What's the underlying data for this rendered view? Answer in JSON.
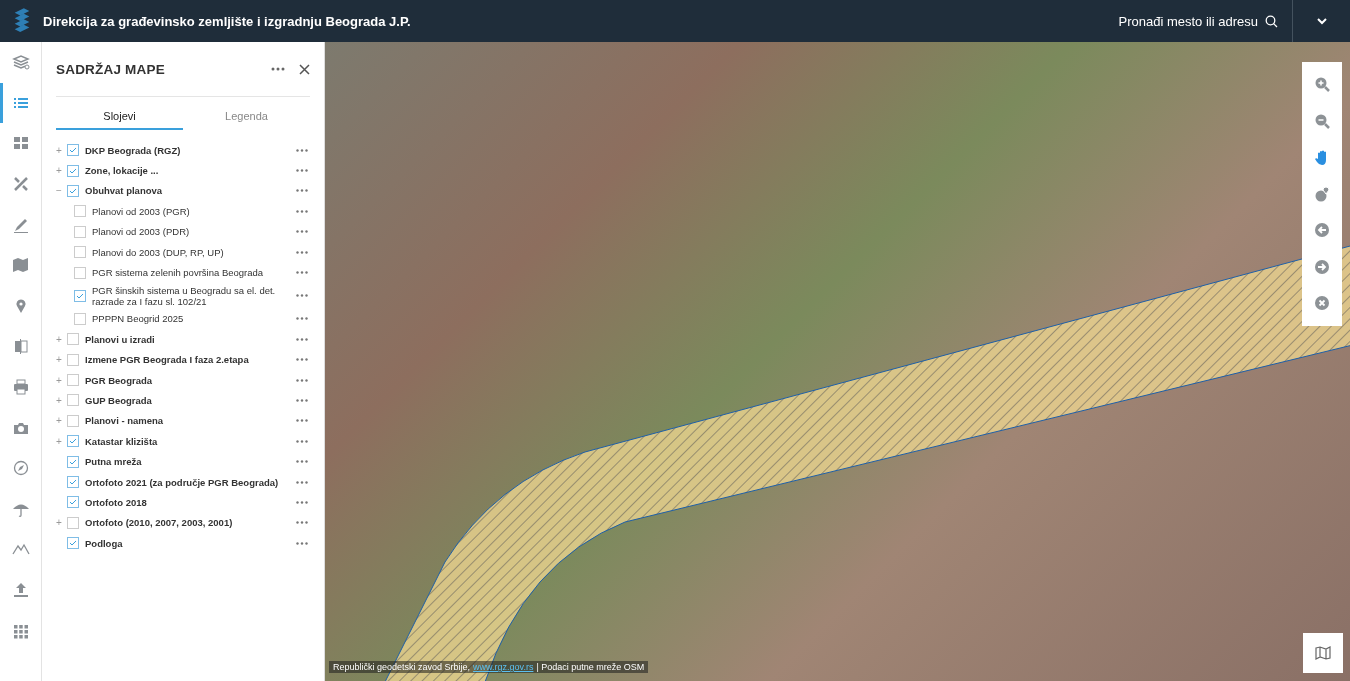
{
  "header": {
    "title": "Direkcija za građevinsko zemljište i izgradnju Beograda J.P.",
    "search": {
      "placeholder": "Pronađi mesto ili adresu"
    }
  },
  "rail": [
    {
      "kind": "layers",
      "selected": false
    },
    {
      "kind": "list",
      "selected": true
    },
    {
      "kind": "grid",
      "selected": false
    },
    {
      "kind": "tools",
      "selected": false
    },
    {
      "kind": "pen",
      "selected": false
    },
    {
      "kind": "map",
      "selected": false
    },
    {
      "kind": "pin",
      "selected": false
    },
    {
      "kind": "split",
      "selected": false
    },
    {
      "kind": "print",
      "selected": false
    },
    {
      "kind": "camera",
      "selected": false
    },
    {
      "kind": "compass",
      "selected": false
    },
    {
      "kind": "umbrella",
      "selected": false
    },
    {
      "kind": "mountains",
      "selected": false
    },
    {
      "kind": "upload",
      "selected": false
    },
    {
      "kind": "apps",
      "selected": false
    }
  ],
  "panel": {
    "title": "SADRŽAJ MAPE",
    "tabs": [
      {
        "label": "Slojevi",
        "selected": true
      },
      {
        "label": "Legenda",
        "selected": false
      }
    ],
    "layers": [
      {
        "label": "DKP Beograda (RGZ)",
        "toggle": "+",
        "checked": true
      },
      {
        "label": "Zone, lokacije ...",
        "toggle": "+",
        "checked": true
      },
      {
        "label": "Obuhvat planova",
        "toggle": "−",
        "checked": true,
        "children": [
          {
            "label": "Planovi od 2003 (PGR)",
            "checked": false
          },
          {
            "label": "Planovi od 2003 (PDR)",
            "checked": false
          },
          {
            "label": "Planovi do 2003 (DUP, RP, UP)",
            "checked": false
          },
          {
            "label": "PGR sistema zelenih površina Beograda",
            "checked": false
          },
          {
            "label": "PGR šinskih sistema u Beogradu sa el. det. razrade za I fazu sl. 102/21",
            "checked": true
          },
          {
            "label": "PPPPN Beogrid 2025",
            "checked": false
          }
        ]
      },
      {
        "label": "Planovi u izradi",
        "toggle": "+",
        "checked": false
      },
      {
        "label": "Izmene PGR Beograda I faza 2.etapa",
        "toggle": "+",
        "checked": false
      },
      {
        "label": "PGR Beograda",
        "toggle": "+",
        "checked": false
      },
      {
        "label": "GUP Beograda",
        "toggle": "+",
        "checked": false
      },
      {
        "label": "Planovi - namena",
        "toggle": "+",
        "checked": false
      },
      {
        "label": "Katastar klizišta",
        "toggle": "+",
        "checked": true
      },
      {
        "label": "Putna mreža",
        "checked": true
      },
      {
        "label": "Ortofoto 2021 (za područje PGR Beograda)",
        "checked": true
      },
      {
        "label": "Ortofoto 2018",
        "checked": true
      },
      {
        "label": "Ortofoto (2010, 2007, 2003, 2001)",
        "toggle": "+",
        "checked": false
      },
      {
        "label": "Podloga",
        "checked": true
      }
    ]
  },
  "map": {
    "tools": [
      {
        "kind": "zoomin",
        "selected": false
      },
      {
        "kind": "zoomout",
        "selected": false
      },
      {
        "kind": "pan",
        "selected": true
      },
      {
        "kind": "locate",
        "selected": false
      },
      {
        "kind": "back",
        "selected": false
      },
      {
        "kind": "forward",
        "selected": false
      },
      {
        "kind": "clear",
        "selected": false
      }
    ],
    "attribution": {
      "text": "Republički geodetski zavod Srbije,",
      "link": "www.rgz.gov.rs",
      "rest": "| Podaci putne mreže OSM"
    }
  }
}
